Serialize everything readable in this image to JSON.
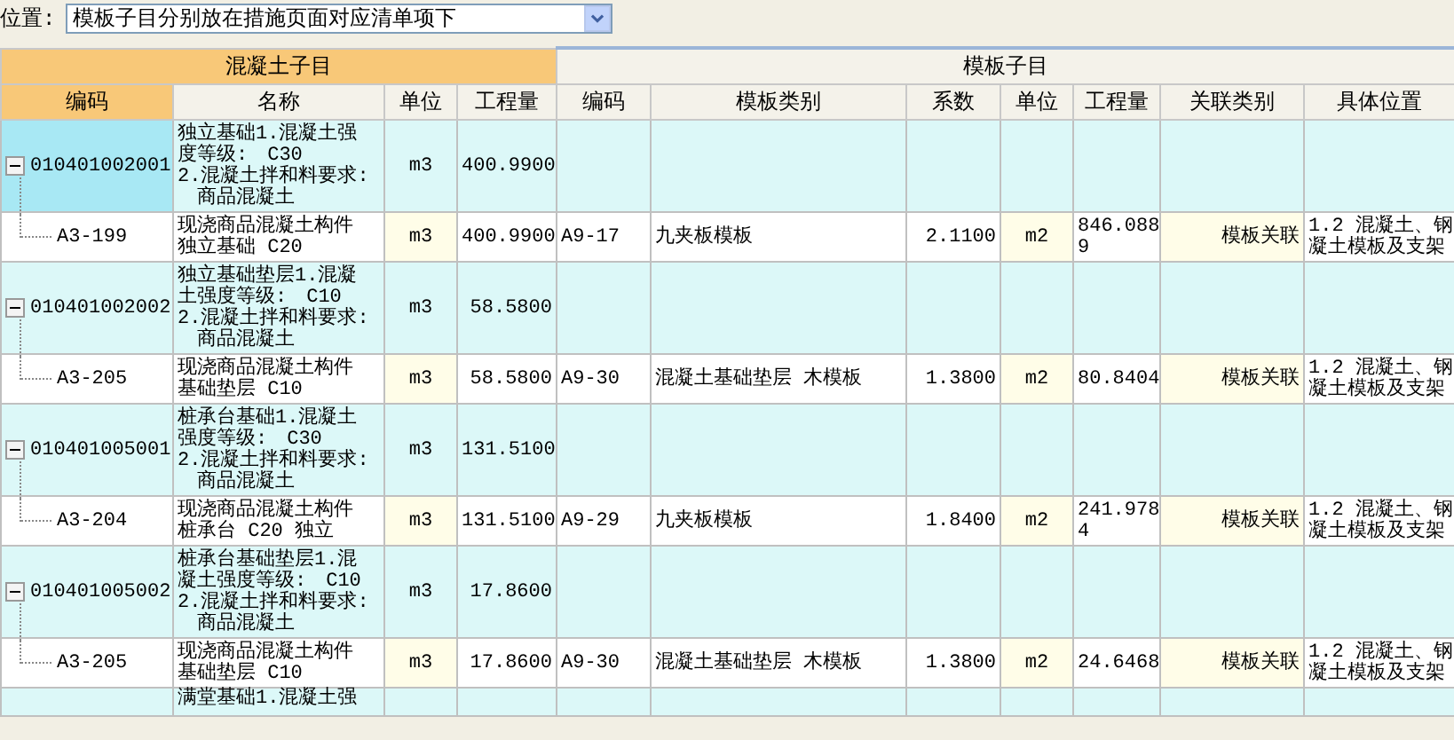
{
  "position_select": {
    "label": "位置:",
    "value": "模板子目分别放在措施页面对应清单项下"
  },
  "table": {
    "groups": [
      {
        "title": "混凝土子目",
        "kind": "concrete",
        "columns": [
          "编码",
          "名称",
          "单位",
          "工程量"
        ]
      },
      {
        "title": "模板子目",
        "kind": "formwork",
        "columns": [
          "编码",
          "模板类别",
          "系数",
          "单位",
          "工程量",
          "关联类别",
          "具体位置"
        ]
      }
    ],
    "rows": [
      {
        "kind": "item",
        "selected": true,
        "expanded": true,
        "cells": [
          "010401002001",
          [
            "独立基础1.混凝土强",
            "度等级:　C30",
            "2.混凝土拌和料要求:",
            "　商品混凝土"
          ],
          "m3",
          "400.9900"
        ]
      },
      {
        "kind": "sub",
        "selected": false,
        "cells": [
          "A3-199",
          [
            "现浇商品混凝土构件",
            "独立基础 C20"
          ],
          "m3",
          "400.9900",
          "A9-17",
          "九夹板模板",
          "2.1100",
          "m2",
          [
            "846.088",
            "9"
          ],
          "模板关联",
          [
            "1.2 混凝土、钢",
            "凝土模板及支架"
          ]
        ]
      },
      {
        "kind": "item",
        "selected": false,
        "expanded": true,
        "cells": [
          "010401002002",
          [
            "独立基础垫层1.混凝",
            "土强度等级:　C10",
            "2.混凝土拌和料要求:",
            "　商品混凝土"
          ],
          "m3",
          "58.5800"
        ]
      },
      {
        "kind": "sub",
        "selected": false,
        "cells": [
          "A3-205",
          [
            "现浇商品混凝土构件",
            "基础垫层 C10"
          ],
          "m3",
          "58.5800",
          "A9-30",
          "混凝土基础垫层 木模板",
          "1.3800",
          "m2",
          "80.8404",
          "模板关联",
          [
            "1.2 混凝土、钢",
            "凝土模板及支架"
          ]
        ]
      },
      {
        "kind": "item",
        "selected": false,
        "expanded": true,
        "cells": [
          "010401005001",
          [
            "桩承台基础1.混凝土",
            "强度等级:　C30",
            "2.混凝土拌和料要求:",
            "　商品混凝土"
          ],
          "m3",
          "131.5100"
        ]
      },
      {
        "kind": "sub",
        "selected": false,
        "cells": [
          "A3-204",
          [
            "现浇商品混凝土构件",
            "桩承台 C20 独立"
          ],
          "m3",
          "131.5100",
          "A9-29",
          "九夹板模板",
          "1.8400",
          "m2",
          [
            "241.978",
            "4"
          ],
          "模板关联",
          [
            "1.2 混凝土、钢",
            "凝土模板及支架"
          ]
        ]
      },
      {
        "kind": "item",
        "selected": false,
        "expanded": true,
        "cells": [
          "010401005002",
          [
            "桩承台基础垫层1.混",
            "凝土强度等级:　C10",
            "2.混凝土拌和料要求:",
            "　商品混凝土"
          ],
          "m3",
          "17.8600"
        ]
      },
      {
        "kind": "sub",
        "selected": false,
        "cells": [
          "A3-205",
          [
            "现浇商品混凝土构件",
            "基础垫层 C10"
          ],
          "m3",
          "17.8600",
          "A9-30",
          "混凝土基础垫层 木模板",
          "1.3800",
          "m2",
          "24.6468",
          "模板关联",
          [
            "1.2 混凝土、钢",
            "凝土模板及支架"
          ]
        ]
      },
      {
        "kind": "partial",
        "selected": false,
        "cells": [
          null,
          [
            "满堂基础1.混凝土强"
          ]
        ]
      }
    ]
  }
}
